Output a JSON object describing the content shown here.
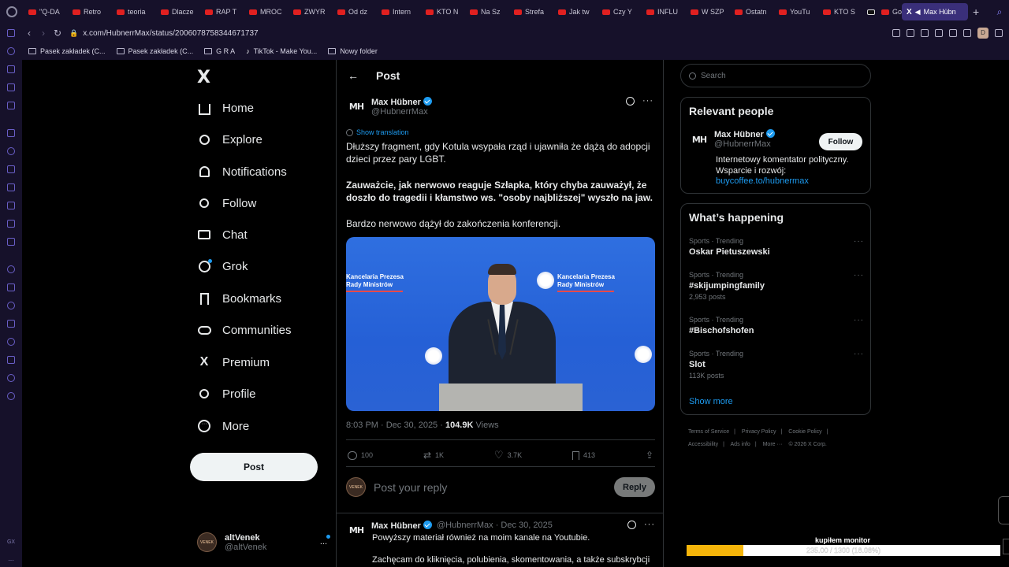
{
  "browser": {
    "tabs": [
      {
        "label": "\"Q-DA"
      },
      {
        "label": "Retro"
      },
      {
        "label": "teoria"
      },
      {
        "label": "Dlacze"
      },
      {
        "label": "RAP T"
      },
      {
        "label": "MROC"
      },
      {
        "label": "ZWYR"
      },
      {
        "label": "Od dz"
      },
      {
        "label": "Intern"
      },
      {
        "label": "KTO N"
      },
      {
        "label": "Na Sz"
      },
      {
        "label": "Strefa"
      },
      {
        "label": "Jak tw"
      },
      {
        "label": "Czy Y"
      },
      {
        "label": "INFLU"
      },
      {
        "label": "W SZP"
      },
      {
        "label": "Ostatn"
      },
      {
        "label": "YouTu"
      },
      {
        "label": "KTO S"
      },
      {
        "label": ""
      },
      {
        "label": "Go"
      }
    ],
    "active_tab": {
      "icon": "X",
      "label": "Max Hübn"
    },
    "new_tab": "+",
    "url": "x.com/HubnerrMax/status/2006078758344671737",
    "profile_initial": "D",
    "bookmarks": [
      {
        "label": "Pasek zakładek (C..."
      },
      {
        "label": "Pasek zakładek (C..."
      },
      {
        "label": "G R A"
      },
      {
        "label": "TikTok - Make You..."
      },
      {
        "label": "Nowy folder"
      }
    ],
    "sidebar_gx": "GX",
    "sidebar_more": "..."
  },
  "nav": {
    "logo": "X",
    "items": [
      {
        "label": "Home"
      },
      {
        "label": "Explore"
      },
      {
        "label": "Notifications"
      },
      {
        "label": "Follow"
      },
      {
        "label": "Chat"
      },
      {
        "label": "Grok"
      },
      {
        "label": "Bookmarks"
      },
      {
        "label": "Communities"
      },
      {
        "label": "Premium"
      },
      {
        "label": "Profile"
      },
      {
        "label": "More"
      }
    ],
    "post_button": "Post",
    "account": {
      "name": "altVenek",
      "handle": "@altVenek",
      "avatar_text": "VENEK",
      "more": "..."
    }
  },
  "main": {
    "title": "Post",
    "post": {
      "avatar": "MH",
      "author": "Max Hübner",
      "handle": "@HubnerrMax",
      "show_translation": "Show translation",
      "paragraphs": [
        "Dłuższy fragment, gdy Kotula wsypała rząd i ujawniła że dążą do adopcji dzieci przez pary LGBT.",
        "Zauważcie, jak nerwowo reaguje Szłapka, który chyba zauważył, że doszło do tragedii i kłamstwo ws. \"osoby najbliższej\" wyszło na jaw.",
        "Bardzo nerwowo dążył do zakończenia konferencji."
      ],
      "media": {
        "banner_left": "Kancelaria Prezesa\nRady Ministrów",
        "banner_right": "Kancelaria Prezesa\nRady Ministrów"
      },
      "time": "8:03 PM · Dec 30, 2025 · ",
      "views": "104.9K",
      "views_label": " Views",
      "stats": {
        "replies": "100",
        "reposts": "1K",
        "likes": "3.7K",
        "bookmarks": "413"
      }
    },
    "reply": {
      "avatar_text": "VENEK",
      "placeholder": "Post your reply",
      "button": "Reply"
    },
    "reply2": {
      "avatar": "MH",
      "author": "Max Hübner",
      "meta": "@HubnerrMax · Dec 30, 2025",
      "text": "Powyższy materiał również na moim kanale na Youtubie.",
      "text2": "Zachęcam do kliknięcia, polubienia, skomentowania, a także subskrybcji"
    }
  },
  "right": {
    "search_placeholder": "Search",
    "relevant": {
      "title": "Relevant people",
      "avatar": "MH",
      "name": "Max Hübner",
      "handle": "@HubnerrMax",
      "follow": "Follow",
      "bio": "Internetowy komentator polityczny. Wsparcie i rozwój:",
      "link": "buycoffee.to/hubnermax"
    },
    "happening": {
      "title": "What’s happening",
      "trends": [
        {
          "category": "Sports · Trending",
          "name": "Oskar Pietuszewski",
          "count": ""
        },
        {
          "category": "Sports · Trending",
          "name": "#skijumpingfamily",
          "count": "2,953 posts"
        },
        {
          "category": "Sports · Trending",
          "name": "#Bischofshofen",
          "count": ""
        },
        {
          "category": "Sports · Trending",
          "name": "Slot",
          "count": "113K posts"
        }
      ],
      "show_more": "Show more"
    },
    "footer": {
      "links": [
        "Terms of Service",
        "|",
        "Privacy Policy",
        "|",
        "Cookie Policy",
        "|",
        "Accessibility",
        "|",
        "Ads info",
        "|",
        "More ···",
        "© 2026 X Corp."
      ]
    }
  },
  "overlay": {
    "label": "kupiłem monitor",
    "progress_text": "235.00 / 1300 (18.08%)",
    "progress_fraction": 0.1808,
    "fill_color": "#f5b50a"
  }
}
